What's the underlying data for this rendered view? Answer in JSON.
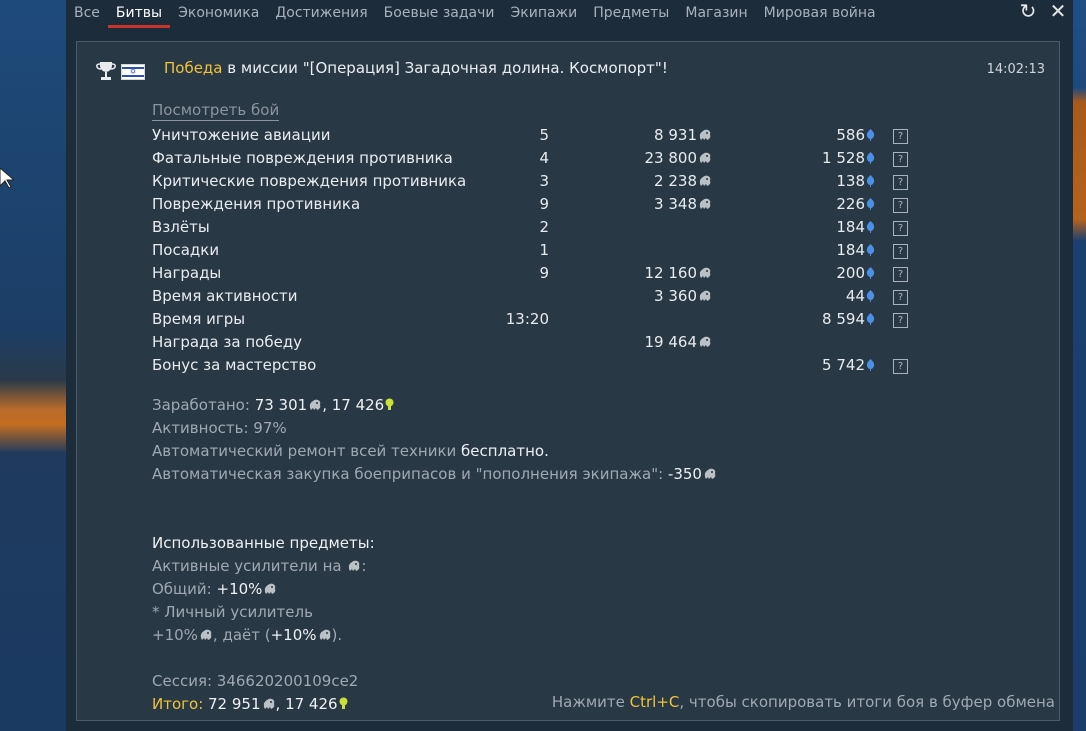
{
  "tabs": [
    "Все",
    "Битвы",
    "Экономика",
    "Достижения",
    "Боевые задачи",
    "Экипажи",
    "Предметы",
    "Магазин",
    "Мировая война"
  ],
  "active_tab": "Битвы",
  "window_buttons": {
    "refresh_glyph": "↻",
    "close_glyph": "✕"
  },
  "header": {
    "result": "Победа",
    "mission_text": " в миссии \"[Операция] Загадочная долина. Космопорт\"!",
    "time": "14:02:13"
  },
  "view_battle_link": "Посмотреть бой",
  "stats": [
    {
      "label": "Уничтожение авиации",
      "count": "5",
      "silver": "8 931",
      "rp": "586"
    },
    {
      "label": "Фатальные повреждения противника",
      "count": "4",
      "silver": "23 800",
      "rp": "1 528"
    },
    {
      "label": "Критические повреждения противника",
      "count": "3",
      "silver": "2 238",
      "rp": "138"
    },
    {
      "label": "Повреждения противника",
      "count": "9",
      "silver": "3 348",
      "rp": "226"
    },
    {
      "label": "Взлёты",
      "count": "2",
      "silver": "",
      "rp": "184"
    },
    {
      "label": "Посадки",
      "count": "1",
      "silver": "",
      "rp": "184"
    },
    {
      "label": "Награды",
      "count": "9",
      "silver": "12 160",
      "rp": "200"
    },
    {
      "label": "Время активности",
      "count": "",
      "silver": "3 360",
      "rp": "44"
    },
    {
      "label": "Время игры",
      "count": "13:20",
      "silver": "",
      "rp": "8 594"
    },
    {
      "label": "Награда за победу",
      "count": "",
      "silver": "19 464",
      "rp": ""
    },
    {
      "label": "Бонус за мастерство",
      "count": "",
      "silver": "",
      "rp": "5 742"
    }
  ],
  "summary": {
    "earned_label": "Заработано: ",
    "earned_silver": "73 301",
    "earned_sep": ", ",
    "earned_rp": "17 426",
    "activity": "Активность: 97%",
    "repair_label": "Автоматический ремонт всей техники ",
    "repair_value": "бесплатно.",
    "purchase_label": "Автоматическая закупка боеприпасов и \"пополнения экипажа\": ",
    "purchase_value": "-350"
  },
  "items": {
    "heading": "Использованные предметы:",
    "boosters_label": "Активные усилители на ",
    "boosters_colon": ":",
    "general_label": "Общий: ",
    "general_value": "+10%",
    "personal_label": "* Личный усилитель",
    "personal_value": "+10%",
    "gives_label": ", даёт (",
    "gives_value": "+10%",
    "gives_close": ")."
  },
  "session": {
    "label": "Сессия: ",
    "value": "346620200109ce2"
  },
  "total": {
    "label": "Итого:",
    "silver": " 72 951",
    "sep": ", ",
    "rp": "17 426"
  },
  "copy_hint": {
    "prefix": "Нажмите ",
    "key": "Ctrl+C",
    "suffix": ", чтобы скопировать итоги боя в буфер обмена"
  },
  "colors": {
    "accent_gold": "#f0c43a",
    "rp_blue": "#4c8fe6",
    "active_tab_underline": "#c6362d",
    "panel_bg": "#283845"
  }
}
